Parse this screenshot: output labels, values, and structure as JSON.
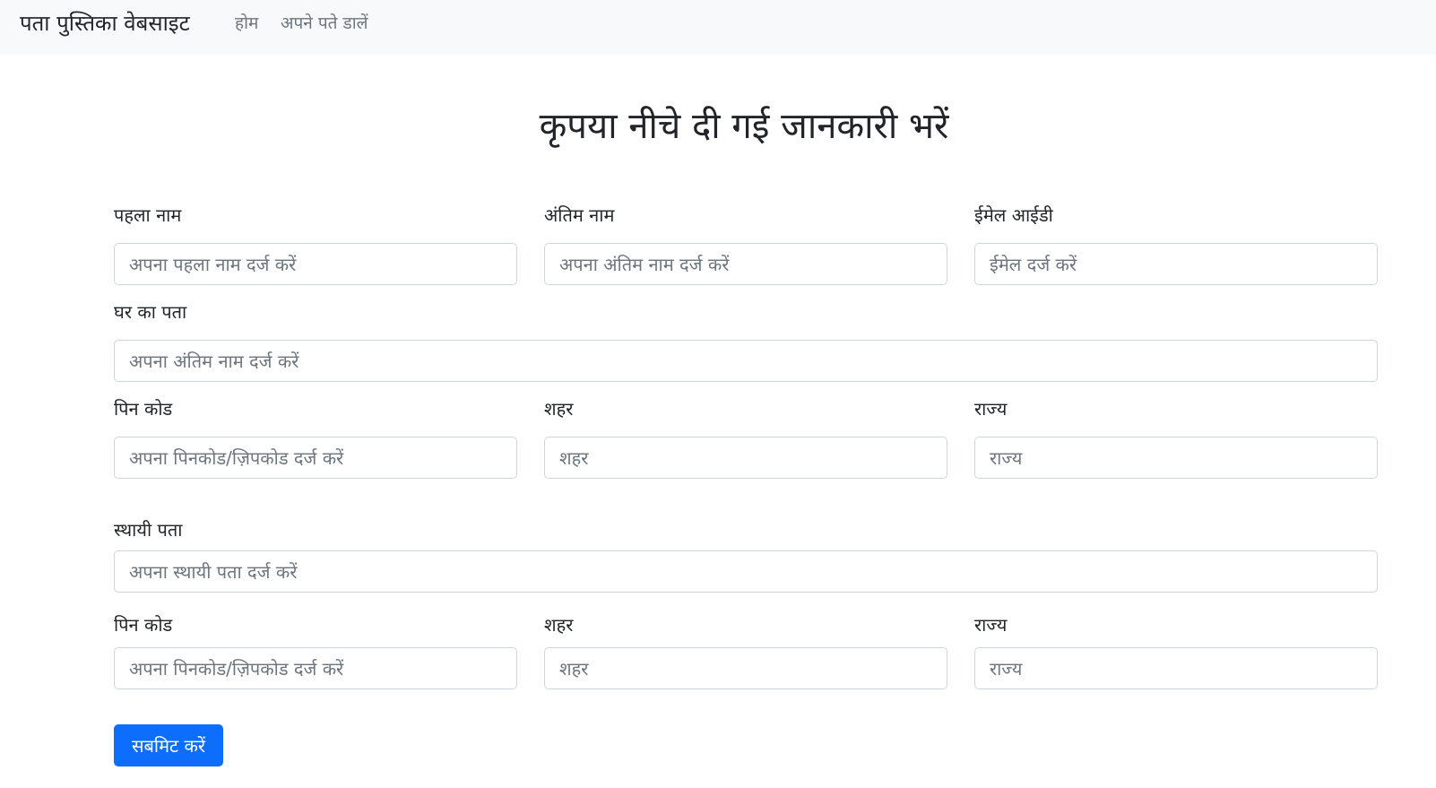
{
  "navbar": {
    "brand": "पता पुस्तिका वेबसाइट",
    "links": [
      "होम",
      "अपने पते डालें"
    ]
  },
  "page_title": "कृपया नीचे दी गई जानकारी भरें",
  "form": {
    "first_name": {
      "label": "पहला नाम",
      "placeholder": "अपना पहला नाम दर्ज करें"
    },
    "last_name": {
      "label": "अंतिम नाम",
      "placeholder": "अपना अंतिम नाम दर्ज करें"
    },
    "email": {
      "label": "ईमेल आईडी",
      "placeholder": "ईमेल दर्ज करें"
    },
    "home_address": {
      "label": "घर का पता",
      "placeholder": "अपना अंतिम नाम दर्ज करें"
    },
    "home_pincode": {
      "label": "पिन कोड",
      "placeholder": "अपना पिनकोड/ज़िपकोड दर्ज करें"
    },
    "home_city": {
      "label": "शहर",
      "placeholder": "शहर"
    },
    "home_state": {
      "label": "राज्य",
      "placeholder": "राज्य"
    },
    "permanent_address": {
      "label": "स्थायी पता",
      "placeholder": "अपना स्थायी पता दर्ज करें"
    },
    "perm_pincode": {
      "label": "पिन कोड",
      "placeholder": "अपना पिनकोड/ज़िपकोड दर्ज करें"
    },
    "perm_city": {
      "label": "शहर",
      "placeholder": "शहर"
    },
    "perm_state": {
      "label": "राज्य",
      "placeholder": "राज्य"
    },
    "submit_label": "सबमिट करें"
  },
  "colors": {
    "navbar_bg": "#f8f9fa",
    "primary": "#0d6efd",
    "nav_link": "#6c757d",
    "input_border": "#ced4da"
  }
}
